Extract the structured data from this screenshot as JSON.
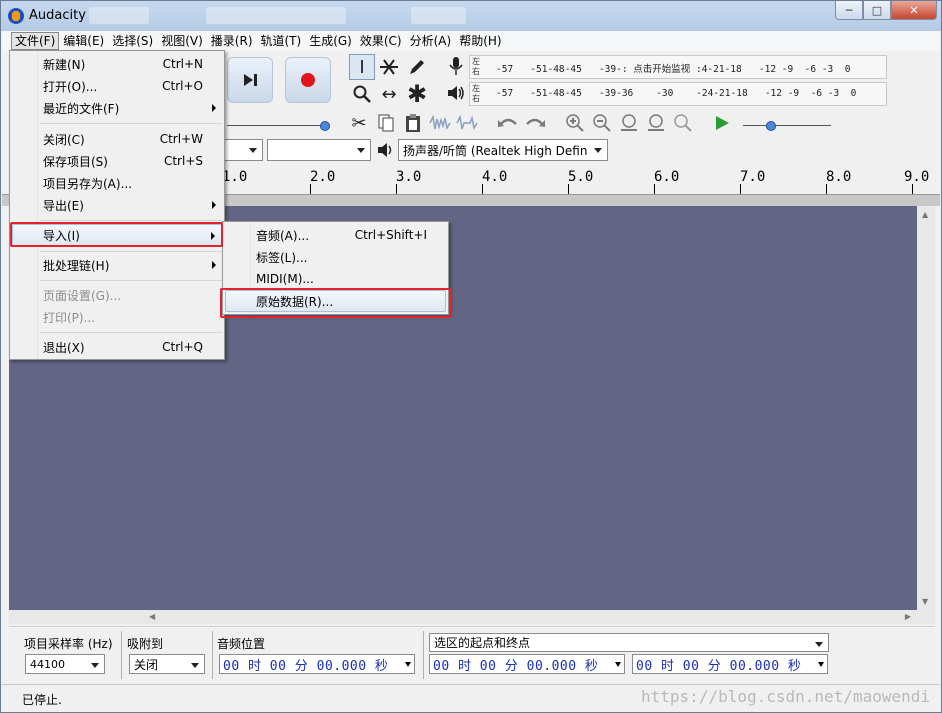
{
  "window": {
    "title": "Audacity"
  },
  "menubar": {
    "items": [
      "文件(F)",
      "编辑(E)",
      "选择(S)",
      "视图(V)",
      "播录(R)",
      "轨道(T)",
      "生成(G)",
      "效果(C)",
      "分析(A)",
      "帮助(H)"
    ]
  },
  "meters": {
    "lr_top": "左",
    "lr_bottom": "右",
    "record_scale": "-57   -51-48-45   -39-: 点击开始监视 :4-21-18   -12 -9  -6 -3  0",
    "play_scale": "-57   -51-48-45   -39-36    -30    -24-21-18   -12 -9  -6 -3  0"
  },
  "device": {
    "output": "扬声器/听筒 (Realtek High Defin"
  },
  "ruler": {
    "labels": [
      "1.0",
      "2.0",
      "3.0",
      "4.0",
      "5.0",
      "6.0",
      "7.0",
      "8.0",
      "9.0"
    ]
  },
  "file_menu": {
    "items": [
      {
        "label": "新建(N)",
        "shortcut": "Ctrl+N"
      },
      {
        "label": "打开(O)...",
        "shortcut": "Ctrl+O"
      },
      {
        "label": "最近的文件(F)",
        "shortcut": ""
      },
      {
        "label": "关闭(C)",
        "shortcut": "Ctrl+W"
      },
      {
        "label": "保存项目(S)",
        "shortcut": "Ctrl+S"
      },
      {
        "label": "项目另存为(A)...",
        "shortcut": ""
      },
      {
        "label": "导出(E)",
        "shortcut": ""
      },
      {
        "label": "导入(I)",
        "shortcut": ""
      },
      {
        "label": "批处理链(H)",
        "shortcut": ""
      },
      {
        "label": "页面设置(G)...",
        "shortcut": ""
      },
      {
        "label": "打印(P)...",
        "shortcut": ""
      },
      {
        "label": "退出(X)",
        "shortcut": "Ctrl+Q"
      }
    ]
  },
  "import_menu": {
    "items": [
      {
        "label": "音频(A)...",
        "shortcut": "Ctrl+Shift+I"
      },
      {
        "label": "标签(L)...",
        "shortcut": ""
      },
      {
        "label": "MIDI(M)...",
        "shortcut": ""
      },
      {
        "label": "原始数据(R)...",
        "shortcut": ""
      }
    ]
  },
  "selection_bar": {
    "rate_label": "项目采样率 (Hz)",
    "rate_value": "44100",
    "snap_label": "吸附到",
    "snap_value": "关闭",
    "position_label": "音频位置",
    "position_value": "00 时 00 分 00.000 秒",
    "range_select": "选区的起点和终点",
    "start_value": "00 时 00 分 00.000 秒",
    "end_value": "00 时 00 分 00.000 秒"
  },
  "status": {
    "text": "已停止.",
    "watermark": "https://blog.csdn.net/maowendi"
  },
  "colors": {
    "track_bg": "#636584",
    "highlight": "#e3232c",
    "time_text": "#1a2fb8"
  }
}
